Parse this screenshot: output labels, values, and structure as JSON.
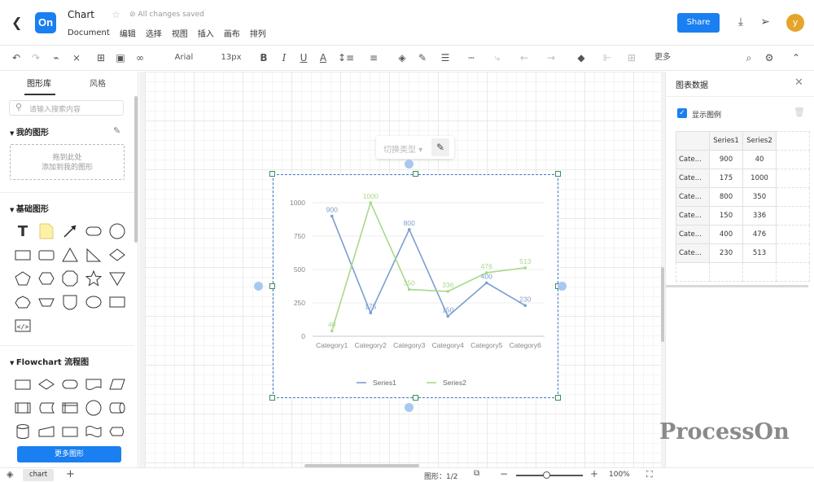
{
  "app": {
    "logo": "On",
    "doc_title": "Chart",
    "save_state": "All changes saved",
    "share_label": "Share",
    "avatar_letter": "y",
    "brand_color": "#1a7ff0"
  },
  "menu": [
    "Document",
    "编辑",
    "选择",
    "视图",
    "插入",
    "画布",
    "排列"
  ],
  "toolbar": {
    "font": "Arial",
    "font_size": "13px",
    "more_label": "更多"
  },
  "left_panel": {
    "tabs": [
      "图形库",
      "风格"
    ],
    "search_placeholder": "请输入搜索内容",
    "my_shapes_title": "我的图形",
    "dropzone_text": [
      "拖到此处",
      "添加到我的图形"
    ],
    "basic_title": "基础图形",
    "flowchart_title": "Flowchart 流程图",
    "more_shapes_label": "更多图形"
  },
  "canvas": {
    "switch_type_label": "切换类型"
  },
  "chart_data": {
    "type": "line",
    "categories": [
      "Category1",
      "Category2",
      "Category3",
      "Category4",
      "Category5",
      "Category6"
    ],
    "series": [
      {
        "name": "Series1",
        "values": [
          900,
          175,
          800,
          150,
          400,
          230
        ],
        "color": "#7b9ed0"
      },
      {
        "name": "Series2",
        "values": [
          40,
          1000,
          350,
          336,
          476,
          513
        ],
        "color": "#a8d98a"
      }
    ],
    "ylim": [
      0,
      1000
    ],
    "yticks": [
      "0",
      "250",
      "500",
      "750",
      "1000"
    ],
    "data_labels": [
      "900",
      "175",
      "800",
      "150",
      "400",
      "230",
      "40",
      "1000",
      "350",
      "336",
      "476",
      "513"
    ],
    "legend_position": "bottom",
    "grid": true
  },
  "right_panel": {
    "title": "图表数据",
    "show_legend_label": "显示图例",
    "table": {
      "headers": [
        "Series1",
        "Series2"
      ],
      "row_labels": [
        "Cate...",
        "Cate...",
        "Cate...",
        "Cate...",
        "Cate...",
        "Cate..."
      ],
      "rows": [
        [
          "900",
          "40"
        ],
        [
          "175",
          "1000"
        ],
        [
          "800",
          "350"
        ],
        [
          "150",
          "336"
        ],
        [
          "400",
          "476"
        ],
        [
          "230",
          "513"
        ]
      ]
    }
  },
  "status": {
    "sheet_tab": "chart",
    "shape_count": "图形：1/2",
    "zoom": "100%"
  },
  "watermark": "ProcessOn"
}
